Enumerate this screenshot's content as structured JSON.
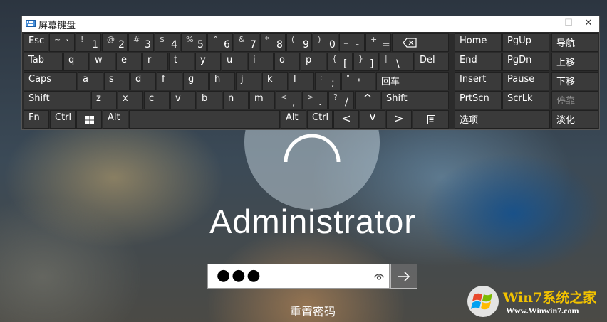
{
  "osk": {
    "title": "屏幕键盘",
    "minimize": "—",
    "maximize": "☐",
    "close": "✕"
  },
  "keys": {
    "esc": "Esc",
    "tilde_top": "~",
    "tilde_bot": "`",
    "d1_top": "!",
    "d1_bot": "1",
    "d2_top": "@",
    "d2_bot": "2",
    "d3_top": "#",
    "d3_bot": "3",
    "d4_top": "$",
    "d4_bot": "4",
    "d5_top": "%",
    "d5_bot": "5",
    "d6_top": "^",
    "d6_bot": "6",
    "d7_top": "&",
    "d7_bot": "7",
    "d8_top": "*",
    "d8_bot": "8",
    "d9_top": "(",
    "d9_bot": "9",
    "d0_top": ")",
    "d0_bot": "0",
    "minus_top": "_",
    "minus_bot": "-",
    "eq_top": "+",
    "eq_bot": "=",
    "tab": "Tab",
    "q": "q",
    "w": "w",
    "e": "e",
    "r": "r",
    "t": "t",
    "y": "y",
    "u": "u",
    "i": "i",
    "o": "o",
    "p": "p",
    "lbr_top": "{",
    "lbr_bot": "[",
    "rbr_top": "}",
    "rbr_bot": "]",
    "bs_top": "|",
    "bs_bot": "\\",
    "del": "Del",
    "caps": "Caps",
    "a": "a",
    "s": "s",
    "d": "d",
    "f": "f",
    "g": "g",
    "h": "h",
    "j": "j",
    "k": "k",
    "l": "l",
    "semi_top": ":",
    "semi_bot": ";",
    "quote_top": "\"",
    "quote_bot": "'",
    "enter": "回车",
    "shift": "Shift",
    "z": "z",
    "x": "x",
    "c": "c",
    "v": "v",
    "b": "b",
    "n": "n",
    "m": "m",
    "comma_top": "<",
    "comma_bot": ",",
    "dot_top": ">",
    "dot_bot": ".",
    "slash_top": "?",
    "slash_bot": "/",
    "up": "^",
    "shift_r": "Shift",
    "fn": "Fn",
    "ctrl": "Ctrl",
    "alt": "Alt",
    "alt_r": "Alt",
    "ctrl_r": "Ctrl",
    "left": "<",
    "down": "v",
    "right": ">",
    "home": "Home",
    "pgup": "PgUp",
    "nav": "导航",
    "end": "End",
    "pgdn": "PgDn",
    "moveup": "上移",
    "insert": "Insert",
    "pause": "Pause",
    "movedown": "下移",
    "prtscn": "PrtScn",
    "scrlk": "ScrLk",
    "dock": "停靠",
    "options": "选项",
    "fade": "淡化"
  },
  "login": {
    "username": "Administrator",
    "password_mask": "●●●",
    "reset_password": "重置密码"
  },
  "watermark": {
    "brand": "Win7系统之家",
    "url": "Www.Winwin7.com"
  },
  "colors": {
    "key_bg": "#3a3a3a",
    "osk_bg": "#2b2b2b",
    "brand_yellow": "#f2c200"
  }
}
